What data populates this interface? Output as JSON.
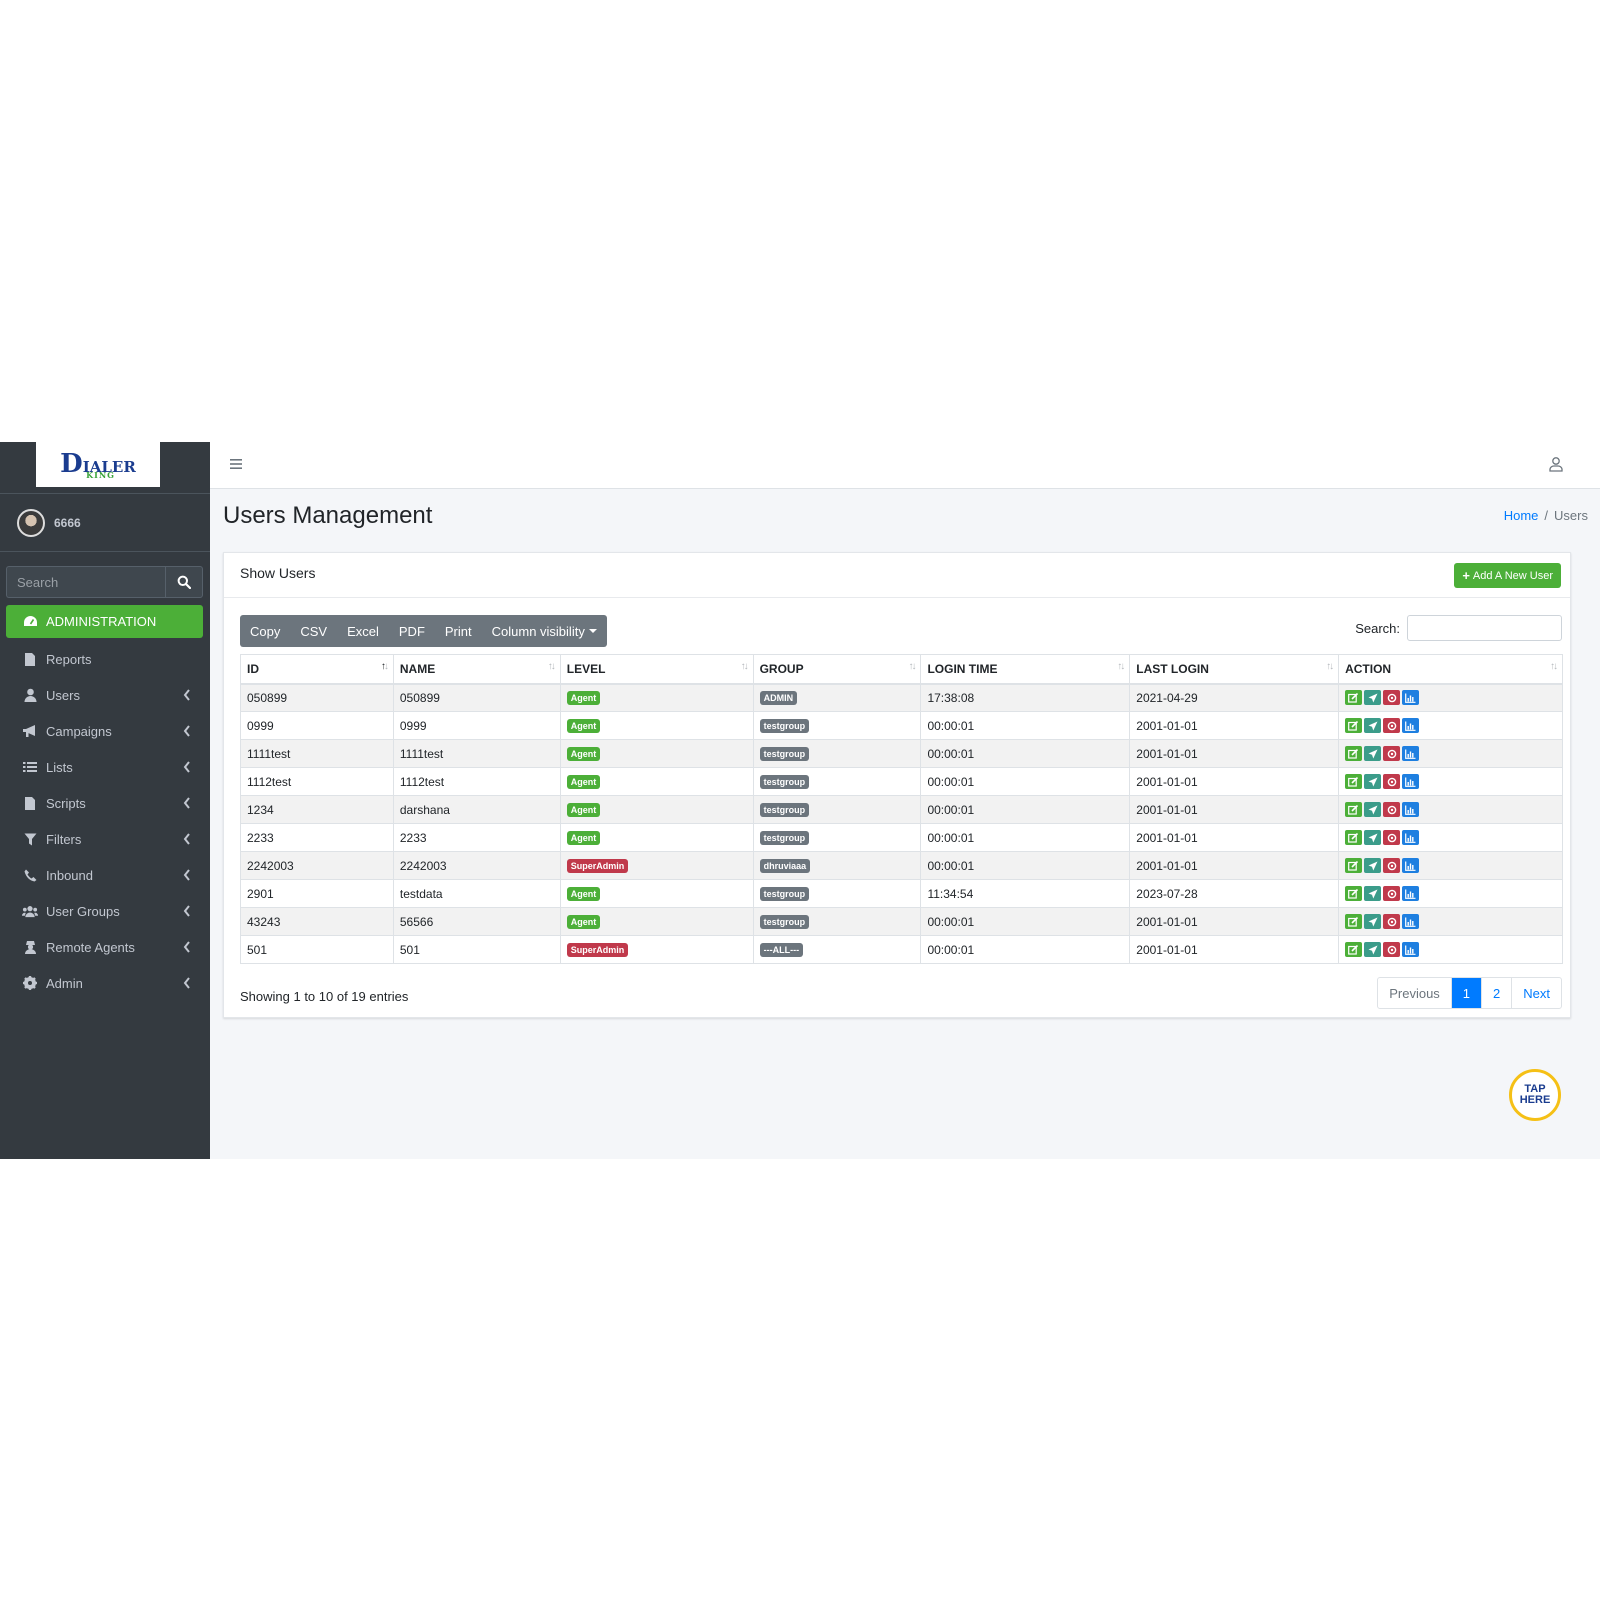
{
  "brand": {
    "logo_main": "D",
    "logo_rest": "IALER",
    "logo_sub": "KING"
  },
  "user": {
    "name": "6666"
  },
  "sidebar": {
    "search_placeholder": "Search",
    "items": [
      {
        "label": "ADMINISTRATION",
        "icon": "tachometer-icon",
        "active": true
      },
      {
        "label": "Reports",
        "icon": "file-icon"
      },
      {
        "label": "Users",
        "icon": "user-icon"
      },
      {
        "label": "Campaigns",
        "icon": "bullhorn-icon"
      },
      {
        "label": "Lists",
        "icon": "list-icon"
      },
      {
        "label": "Scripts",
        "icon": "file-icon"
      },
      {
        "label": "Filters",
        "icon": "filter-icon"
      },
      {
        "label": "Inbound",
        "icon": "phone-icon"
      },
      {
        "label": "User Groups",
        "icon": "users-icon"
      },
      {
        "label": "Remote Agents",
        "icon": "user-secret-icon"
      },
      {
        "label": "Admin",
        "icon": "gear-icon"
      }
    ]
  },
  "header": {
    "page_title": "Users Management",
    "breadcrumb": {
      "home": "Home",
      "sep": "/",
      "current": "Users"
    }
  },
  "card": {
    "title": "Show Users",
    "add_button": "Add A New User",
    "export_buttons": [
      "Copy",
      "CSV",
      "Excel",
      "PDF",
      "Print",
      "Column visibility"
    ],
    "search_label": "Search:"
  },
  "table": {
    "columns": [
      "ID",
      "NAME",
      "LEVEL",
      "GROUP",
      "LOGIN TIME",
      "LAST LOGIN",
      "ACTION"
    ],
    "rows": [
      [
        "050899",
        "050899",
        "Agent",
        "ADMIN",
        "17:38:08",
        "2021-04-29"
      ],
      [
        "0999",
        "0999",
        "Agent",
        "testgroup",
        "00:00:01",
        "2001-01-01"
      ],
      [
        "1111test",
        "1111test",
        "Agent",
        "testgroup",
        "00:00:01",
        "2001-01-01"
      ],
      [
        "1112test",
        "1112test",
        "Agent",
        "testgroup",
        "00:00:01",
        "2001-01-01"
      ],
      [
        "1234",
        "darshana",
        "Agent",
        "testgroup",
        "00:00:01",
        "2001-01-01"
      ],
      [
        "2233",
        "2233",
        "Agent",
        "testgroup",
        "00:00:01",
        "2001-01-01"
      ],
      [
        "2242003",
        "2242003",
        "SuperAdmin",
        "dhruviaaa",
        "00:00:01",
        "2001-01-01"
      ],
      [
        "2901",
        "testdata",
        "Agent",
        "testgroup",
        "11:34:54",
        "2023-07-28"
      ],
      [
        "43243",
        "56566",
        "Agent",
        "testgroup",
        "00:00:01",
        "2001-01-01"
      ],
      [
        "501",
        "501",
        "SuperAdmin",
        "---ALL---",
        "00:00:01",
        "2001-01-01"
      ]
    ]
  },
  "footer": {
    "info": "Showing 1 to 10 of 19 entries",
    "pagination": [
      "Previous",
      "1",
      "2",
      "Next"
    ]
  },
  "tap": {
    "line1": "TAP",
    "line2": "HERE"
  },
  "colors": {
    "sidebar": "#343a40",
    "accent_green": "#4caf38",
    "danger": "#c0394b",
    "primary": "#007bff"
  }
}
